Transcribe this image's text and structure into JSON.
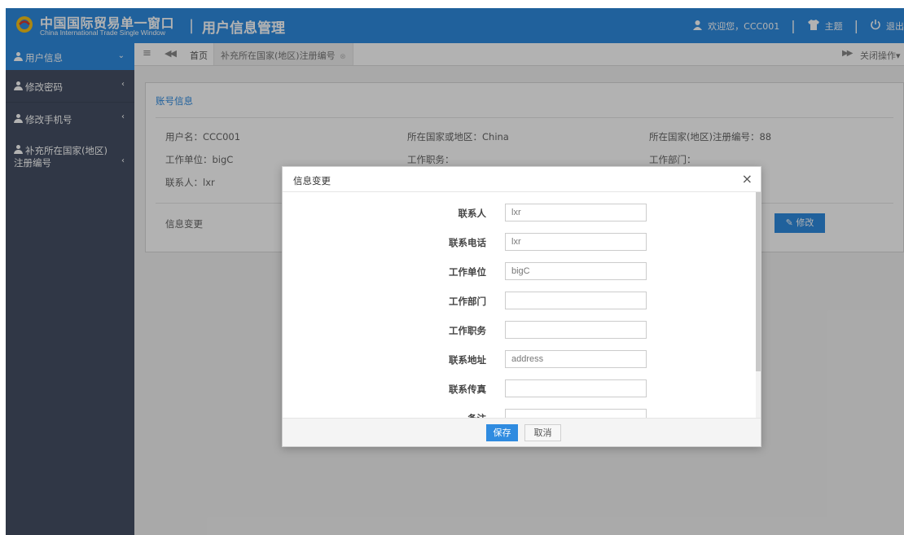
{
  "header": {
    "brand_cn": "中国国际贸易单一窗口",
    "brand_en": "China International Trade Single Window",
    "separator": "|",
    "title": "用户信息管理",
    "welcome": "欢迎您，CCC001",
    "theme_label": "主题",
    "logout_label": "退出"
  },
  "sidebar": {
    "items": [
      {
        "label": "用户信息",
        "chevron": "⌄"
      },
      {
        "label": "修改密码",
        "chevron": "‹"
      },
      {
        "label": "修改手机号",
        "chevron": "‹"
      },
      {
        "label": "补充所在国家(地区)",
        "label2": "注册编号",
        "chevron": "‹"
      }
    ]
  },
  "tabbar": {
    "home": "首页",
    "active_tab": "补充所在国家(地区)注册编号",
    "close_ops": "关闭操作"
  },
  "panel": {
    "title": "账号信息",
    "fields": {
      "username": "用户名：CCC001",
      "country": "所在国家或地区：China",
      "reg_no": "所在国家(地区)注册编号：88",
      "work_unit": "工作单位：bigC",
      "job_title": "工作职务：",
      "department": "工作部门：",
      "contact": "联系人：lxr"
    },
    "change_label": "信息变更",
    "edit_button": "修改"
  },
  "modal": {
    "title": "信息变更",
    "close": "×",
    "rows": [
      {
        "label": "联系人",
        "value": "lxr"
      },
      {
        "label": "联系电话",
        "value": "lxr"
      },
      {
        "label": "工作单位",
        "value": "bigC"
      },
      {
        "label": "工作部门",
        "value": ""
      },
      {
        "label": "工作职务",
        "value": ""
      },
      {
        "label": "联系地址",
        "value": "address"
      },
      {
        "label": "联系传真",
        "value": ""
      },
      {
        "label": "备注",
        "value": ""
      }
    ],
    "save": "保存",
    "cancel": "取消"
  },
  "colors": {
    "accent": "#2f8be0",
    "sidebar": "#455065",
    "overlay": "rgba(0,0,0,0.30)"
  }
}
